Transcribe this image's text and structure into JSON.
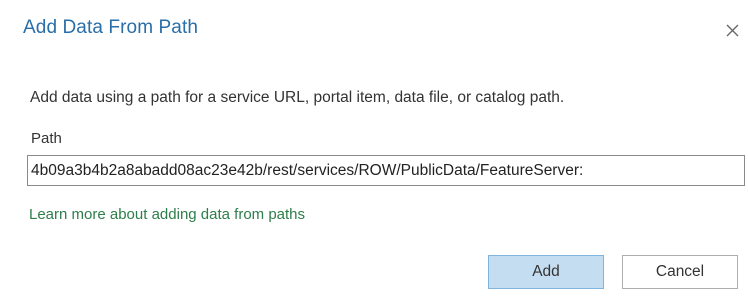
{
  "dialog": {
    "title": "Add Data From Path",
    "close_icon": "close-icon",
    "description": "Add data using a path for a service URL, portal item, data file, or catalog path.",
    "path_label": "Path",
    "path_value": ":4b09a3b4b2a8abadd08ac23e42b/rest/services/ROW/PublicData/FeatureServer",
    "learn_more_link": "Learn more about adding data from paths",
    "add_label": "Add",
    "cancel_label": "Cancel"
  },
  "colors": {
    "title": "#2a6ea8",
    "link": "#2e7d4a",
    "primary_button_bg": "#c5ddf1",
    "primary_button_border": "#7eb4de"
  }
}
